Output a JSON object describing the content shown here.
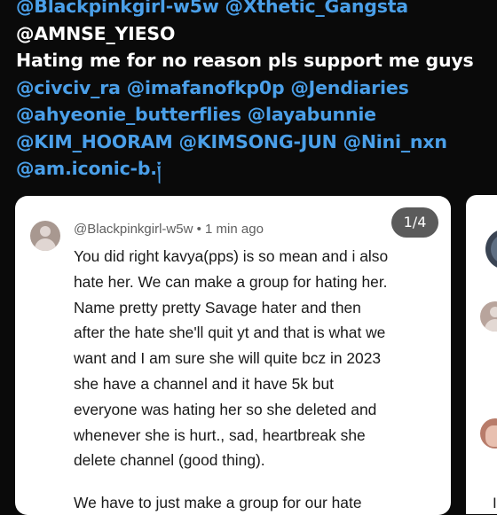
{
  "post": {
    "lines": [
      {
        "m1": "@Blackpinkgirl-w5w",
        "m2": "@Xthetic_Gangsta"
      },
      {
        "t": "@AMNSE_YIESO"
      },
      {
        "t": "Hating me for no reason pls support me guys"
      },
      {
        "m1": "@civciv_ra",
        "m2": "@imafanofkp0p",
        "m3": "@Jendiaries"
      },
      {
        "m1": "@ahyeonie_butterflies",
        "m2": "@layabunnie"
      },
      {
        "m1": "@KIM_HOORAM",
        "m2": "@KIMSONG-JUN",
        "m3": "@Nini_nxn"
      },
      {
        "m1": "@am.iconic-b.༏"
      }
    ]
  },
  "card": {
    "counter": "1/4",
    "comment": {
      "author": "@Blackpinkgirl-w5w",
      "time": "1 min ago",
      "meta_sep": " • ",
      "lines": [
        "You did right kavya(pps) is so mean and i also",
        "hate her. We can make a group for hating her.",
        "Name pretty pretty Savage hater and then",
        "after the hate she'll quit yt and that is what we",
        "want and I am sure she will quite bcz in 2023",
        "she have a channel and it have 5k but",
        "everyone was hating her so she deleted and",
        "whenever she is hurt., sad, heartbreak she",
        "delete channel (good thing)."
      ],
      "next_line": "We have to just make a group for our hate"
    }
  },
  "side_card": {
    "text": "I"
  },
  "colors": {
    "mention": "#4a9fe8",
    "background": "#0a0a0a",
    "card": "#ffffff",
    "badge": "#5b5b5b"
  }
}
